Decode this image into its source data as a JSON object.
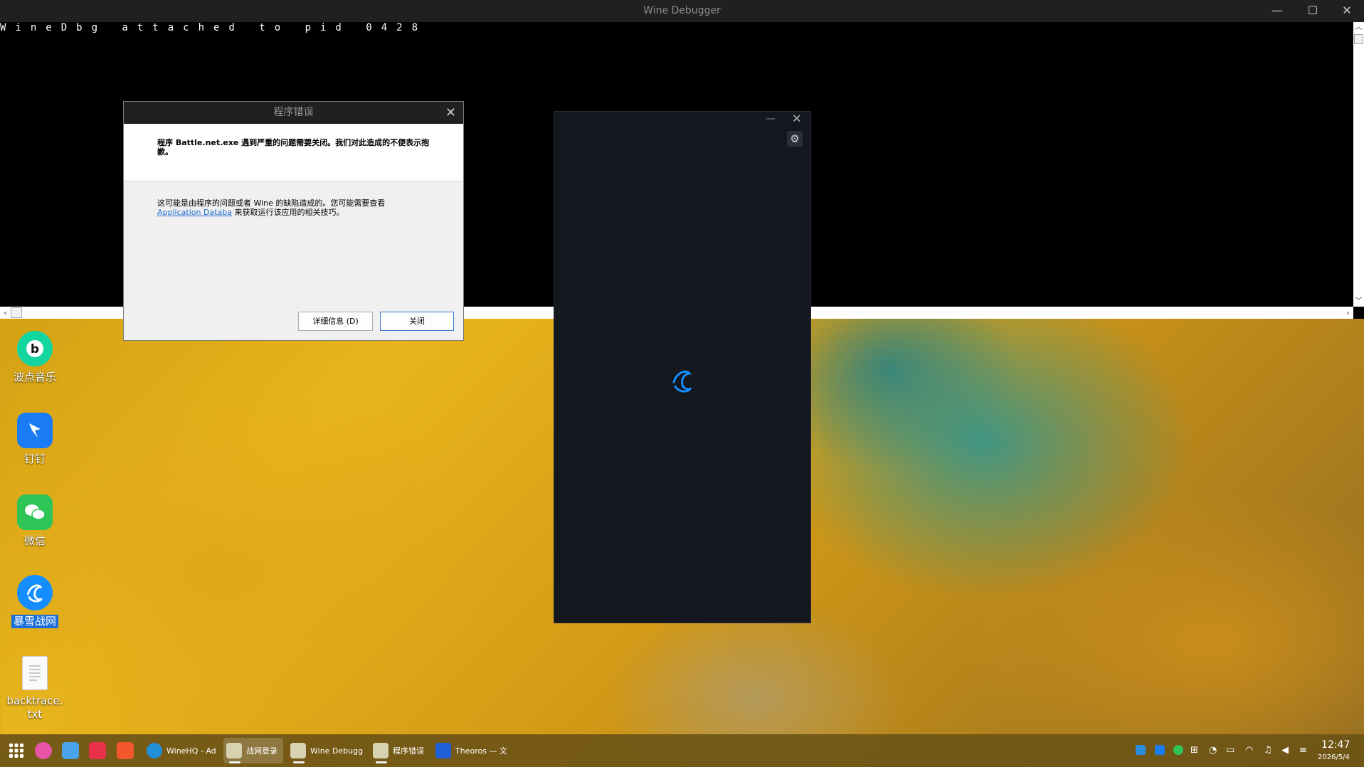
{
  "console": {
    "title": "Wine Debugger",
    "text": "WineDbg attached to pid 0428",
    "minimize_glyph": "—",
    "maximize_glyph": "☐",
    "close_glyph": "✕"
  },
  "error_dialog": {
    "title": "程序错误",
    "close_glyph": "✕",
    "message": "程序 Battle.net.exe 遇到严重的问题需要关闭。我们对此造成的不便表示抱歉。",
    "detail_before_link": "这可能是由程序的问题或者 Wine 的缺陷造成的。您可能需要查看",
    "link_text": "Application Databa",
    "detail_after_link": "来获取运行该应用的相关技巧。",
    "details_button": "详细信息 (D)",
    "close_button": "关闭"
  },
  "battlenet_window": {
    "minimize_glyph": "—",
    "close_glyph": "✕",
    "gear_glyph": "⚙",
    "accent_color": "#148eff"
  },
  "desktop_icons": [
    {
      "label": "波点音乐",
      "icon": "bodian-music-icon"
    },
    {
      "label": "钉钉",
      "icon": "dingtalk-icon"
    },
    {
      "label": "微信",
      "icon": "wechat-icon"
    },
    {
      "label": "暴雪战网",
      "icon": "battlenet-icon"
    },
    {
      "label": "backtrace.txt",
      "icon": "text-file-icon"
    }
  ],
  "taskbar": {
    "apps": [
      {
        "label": "WineHQ - Ad",
        "icon": "edge-browser-icon"
      },
      {
        "label": "战网登录",
        "icon": "wine-window-icon"
      },
      {
        "label": "Wine Debugg",
        "icon": "wine-window-icon"
      },
      {
        "label": "程序错误",
        "icon": "wine-window-icon"
      },
      {
        "label": "Theoros — 文",
        "icon": "notes-icon"
      }
    ],
    "time": "12:47",
    "date": "2026/5/4"
  }
}
